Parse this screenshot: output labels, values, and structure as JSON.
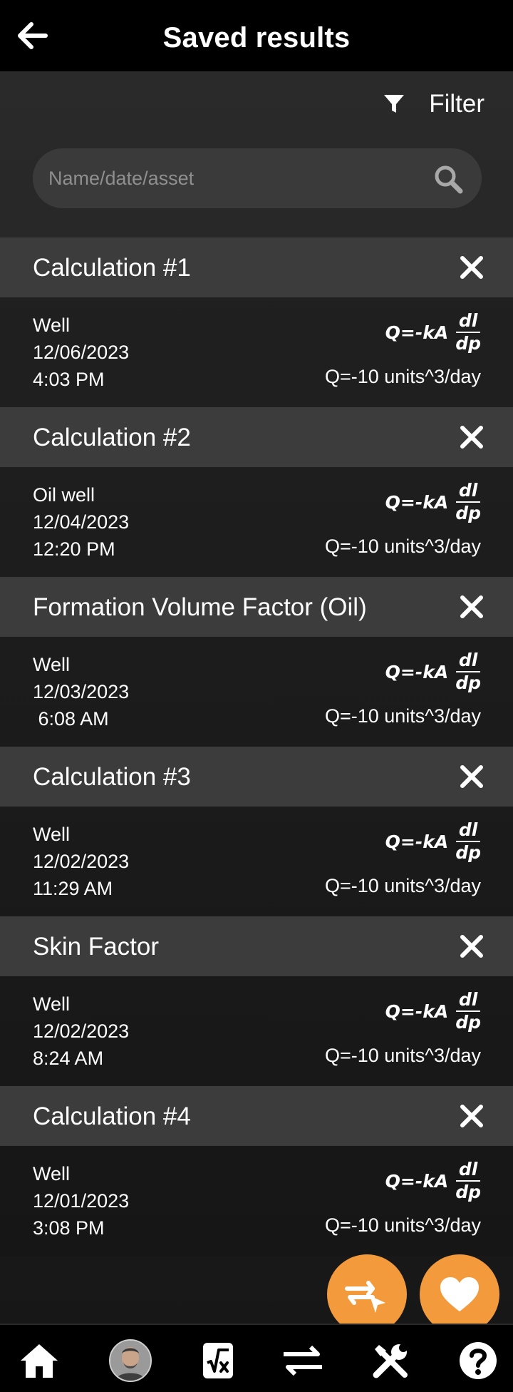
{
  "header": {
    "title": "Saved results",
    "back_icon": "back-arrow-icon"
  },
  "filter": {
    "label": "Filter",
    "icon": "funnel-icon"
  },
  "search": {
    "placeholder": "Name/date/asset",
    "value": "",
    "icon": "search-icon"
  },
  "results": [
    {
      "title": "Calculation #1",
      "asset": "Well",
      "date": "12/06/2023",
      "time": "4:03 PM",
      "formula": "Q=-kA",
      "frac_num": "dl",
      "frac_den": "dp",
      "result": "Q=-10 units^3/day"
    },
    {
      "title": "Calculation #2",
      "asset": "Oil well",
      "date": "12/04/2023",
      "time": "12:20 PM",
      "formula": "Q=-kA",
      "frac_num": "dl",
      "frac_den": "dp",
      "result": "Q=-10 units^3/day"
    },
    {
      "title": "Formation Volume Factor (Oil)",
      "asset": "Well",
      "date": "12/03/2023",
      "time": " 6:08 AM",
      "formula": "Q=-kA",
      "frac_num": "dl",
      "frac_den": "dp",
      "result": "Q=-10 units^3/day"
    },
    {
      "title": "Calculation #3",
      "asset": "Well",
      "date": "12/02/2023",
      "time": "11:29 AM",
      "formula": "Q=-kA",
      "frac_num": "dl",
      "frac_den": "dp",
      "result": "Q=-10 units^3/day"
    },
    {
      "title": "Skin Factor",
      "asset": "Well",
      "date": "12/02/2023",
      "time": "8:24 AM",
      "formula": "Q=-kA",
      "frac_num": "dl",
      "frac_den": "dp",
      "result": "Q=-10 units^3/day"
    },
    {
      "title": "Calculation #4",
      "asset": "Well",
      "date": "12/01/2023",
      "time": "3:08 PM",
      "formula": "Q=-kA",
      "frac_num": "dl",
      "frac_den": "dp",
      "result": "Q=-10 units^3/day"
    }
  ],
  "fabs": {
    "compare_icon": "compare-arrows-icon",
    "favorite_icon": "heart-icon",
    "color": "#f39a3c"
  },
  "bottom_nav": {
    "items": [
      "home-icon",
      "avatar",
      "calculator-sqrt-icon",
      "swap-arrows-icon",
      "tools-icon",
      "help-icon"
    ]
  },
  "colors": {
    "topbar": "#000000",
    "card_header": "#3c3c3c",
    "accent": "#f39a3c",
    "text": "#ffffff"
  }
}
